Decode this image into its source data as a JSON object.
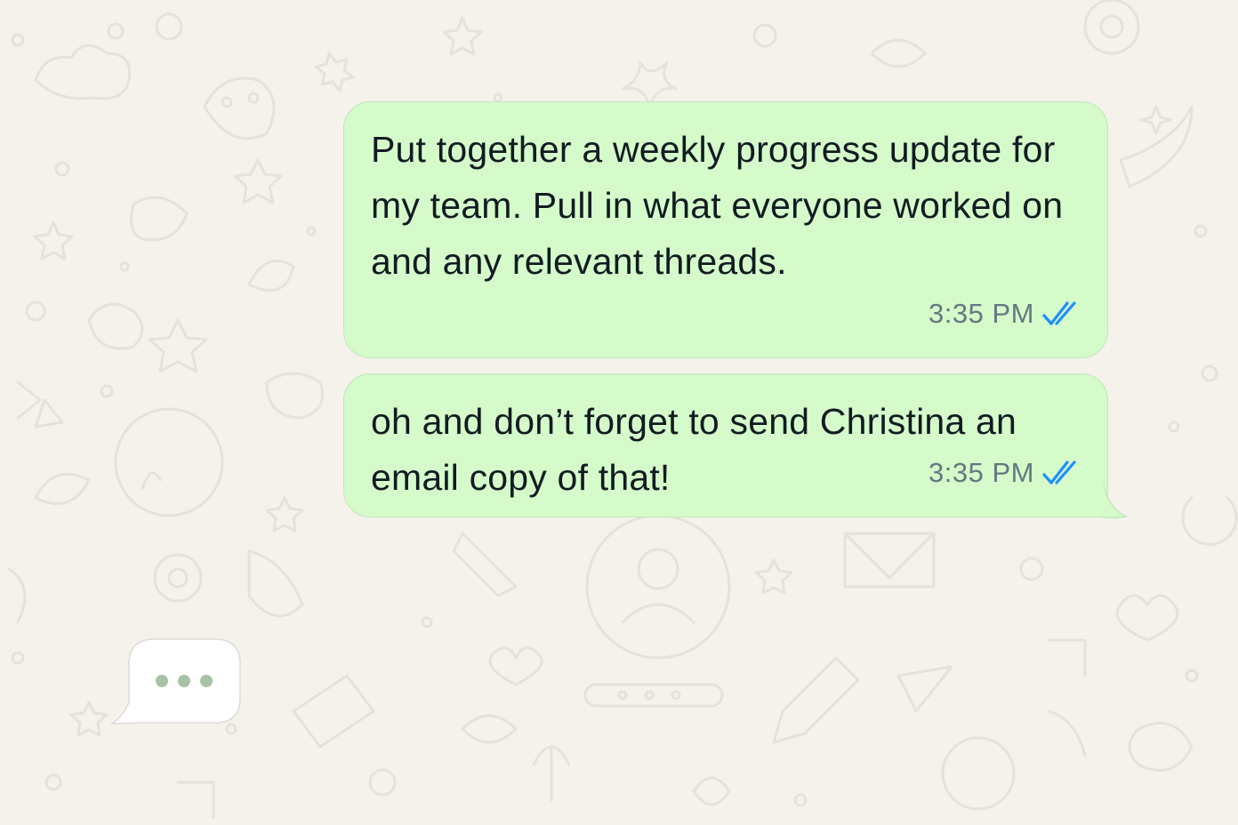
{
  "chat": {
    "background_color": "#f5f2ec",
    "outgoing_bubble_color": "#d5fbcb",
    "read_tick_color": "#1f8fff",
    "messages": [
      {
        "direction": "outgoing",
        "text": "Put together a weekly progress update for my team. Pull in what everyone worked on and any relevant threads.",
        "time": "3:35 PM",
        "status": "read"
      },
      {
        "direction": "outgoing",
        "text": "oh and don’t forget to send Christina an email copy of that!",
        "time": "3:35 PM",
        "status": "read"
      }
    ],
    "typing_indicator": {
      "visible": true,
      "icon": "typing-dots-icon",
      "dot_color": "#a7c2a4"
    }
  }
}
